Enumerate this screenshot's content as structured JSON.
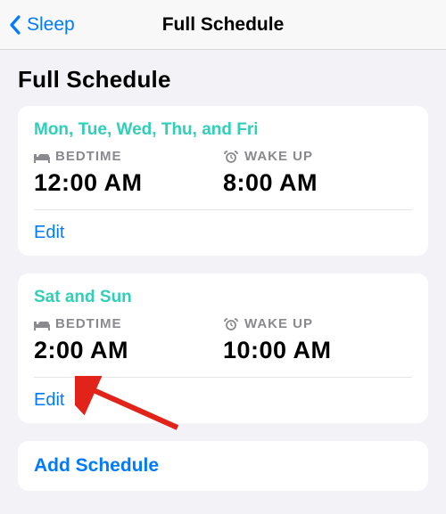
{
  "nav": {
    "back_label": "Sleep",
    "title": "Full Schedule"
  },
  "heading": "Full Schedule",
  "labels": {
    "bedtime": "BEDTIME",
    "wakeup": "WAKE UP",
    "edit": "Edit",
    "add": "Add Schedule"
  },
  "schedules": [
    {
      "days": "Mon, Tue, Wed, Thu, and Fri",
      "bedtime": "12:00 AM",
      "wakeup": "8:00 AM"
    },
    {
      "days": "Sat and Sun",
      "bedtime": "2:00 AM",
      "wakeup": "10:00 AM"
    }
  ]
}
